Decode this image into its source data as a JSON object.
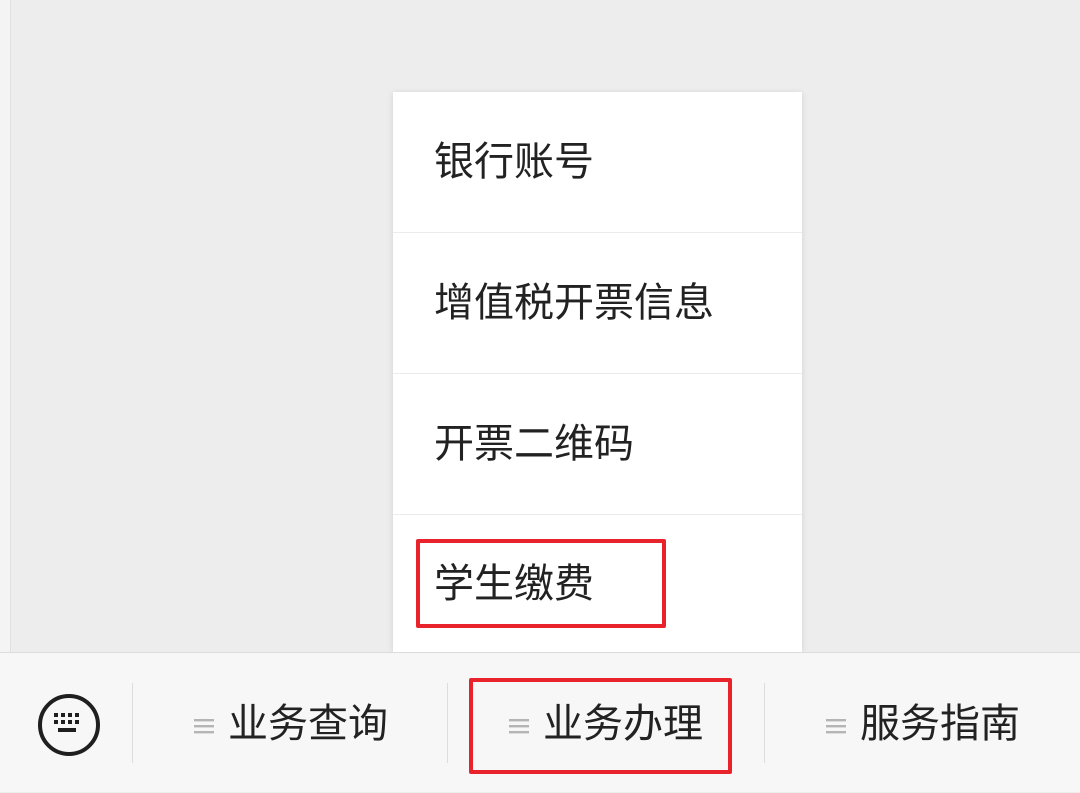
{
  "popup_menu": {
    "items": [
      {
        "label": "银行账号"
      },
      {
        "label": "增值税开票信息"
      },
      {
        "label": "开票二维码"
      },
      {
        "label": "学生缴费"
      }
    ]
  },
  "bottom_bar": {
    "keyboard_icon": "keyboard-icon",
    "tabs": [
      {
        "label": "业务查询",
        "icon": "menu-lines-icon"
      },
      {
        "label": "业务办理",
        "icon": "menu-lines-icon"
      },
      {
        "label": "服务指南",
        "icon": "menu-lines-icon"
      }
    ]
  },
  "colors": {
    "background": "#ededed",
    "menu_background": "#ffffff",
    "bottom_bar": "#f7f7f7",
    "text": "#222222",
    "highlight": "#e8232b",
    "icon_gray": "#b5b5b5"
  }
}
